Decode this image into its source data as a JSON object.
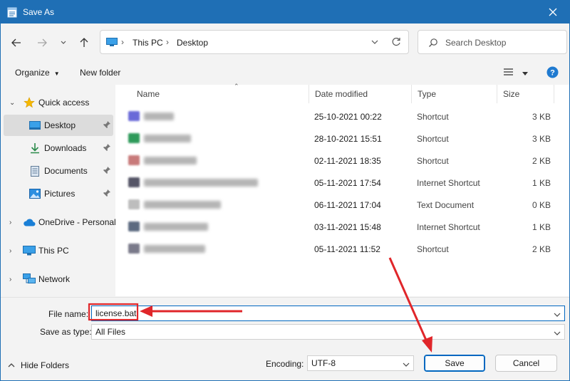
{
  "window": {
    "title": "Save As"
  },
  "address": {
    "crumbs": [
      "This PC",
      "Desktop"
    ]
  },
  "search": {
    "placeholder": "Search Desktop"
  },
  "toolbar": {
    "organize_label": "Organize",
    "new_folder_label": "New folder"
  },
  "nav": {
    "items": [
      {
        "label": "Quick access"
      },
      {
        "label": "Desktop"
      },
      {
        "label": "Downloads"
      },
      {
        "label": "Documents"
      },
      {
        "label": "Pictures"
      },
      {
        "label": "OneDrive - Personal"
      },
      {
        "label": "This PC"
      },
      {
        "label": "Network"
      }
    ]
  },
  "table": {
    "headers": [
      "Name",
      "Date modified",
      "Type",
      "Size"
    ],
    "rows": [
      {
        "date": "25-10-2021 00:22",
        "type": "Shortcut",
        "size": "3 KB",
        "icon_color": "#6a6ad8"
      },
      {
        "date": "28-10-2021 15:51",
        "type": "Shortcut",
        "size": "3 KB",
        "icon_color": "#2e9a5a"
      },
      {
        "date": "02-11-2021 18:35",
        "type": "Shortcut",
        "size": "2 KB",
        "icon_color": "#c87a7a"
      },
      {
        "date": "05-11-2021 17:54",
        "type": "Internet Shortcut",
        "size": "1 KB",
        "icon_color": "#555566"
      },
      {
        "date": "06-11-2021 17:04",
        "type": "Text Document",
        "size": "0 KB",
        "icon_color": "#bdbdbd"
      },
      {
        "date": "03-11-2021 15:48",
        "type": "Internet Shortcut",
        "size": "1 KB",
        "icon_color": "#5c6a80"
      },
      {
        "date": "05-11-2021 11:52",
        "type": "Shortcut",
        "size": "2 KB",
        "icon_color": "#7a7a8a"
      }
    ]
  },
  "form": {
    "file_name_label": "File name:",
    "file_name_value": "license.bat",
    "save_type_label": "Save as type:",
    "save_type_value": "All Files",
    "encoding_label": "Encoding:",
    "encoding_value": "UTF-8"
  },
  "buttons": {
    "save_label": "Save",
    "cancel_label": "Cancel",
    "hide_folders_label": "Hide Folders"
  },
  "colors": {
    "accent": "#1f6fb5",
    "annotation": "#e0262a"
  }
}
